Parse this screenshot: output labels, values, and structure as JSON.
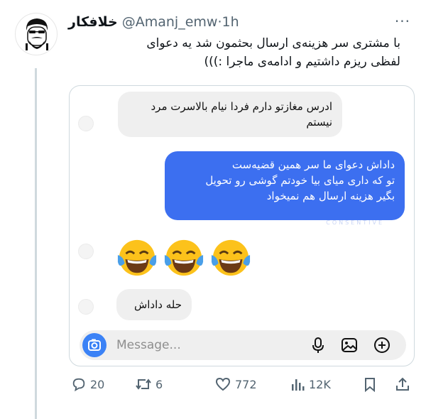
{
  "tweet": {
    "display_name": "خلافکار",
    "handle": "@Amanj_emw",
    "separator": "·",
    "time": "1h",
    "more": "···",
    "text_line1": "با مشتری سر هزینه‌ی ارسال بحثمون شد یه دعوای",
    "text_line2": "لفظی ریزم داشتیم و ادامه‌ی ماجرا :)))"
  },
  "chat": {
    "msg1": "ادرس مغازتو دارم فردا نیام بالاسرت مرد نیستم",
    "msg2_line1": "داداش دعوای ما سر همین قضیه‌ست",
    "msg2_line2": "تو که داری میای بیا خودتم گوشی رو تحویل",
    "msg2_line3": "بگیر هزینه ارسال هم نمیخواد",
    "watermark": "CONSENTIVE",
    "emojis": [
      "joy-emoji",
      "joy-emoji",
      "joy-emoji"
    ],
    "msg3": "حله داداش",
    "composer_placeholder": "Message..."
  },
  "actions": {
    "replies": "20",
    "retweets": "6",
    "likes": "772",
    "views": "12K"
  },
  "icons": [
    "comment-icon",
    "retweet-icon",
    "heart-icon",
    "views-icon",
    "bookmark-icon",
    "share-icon",
    "camera-icon",
    "mic-icon",
    "gallery-icon",
    "add-icon"
  ],
  "colors": {
    "outgoing_bubble": "#3c6ff0",
    "incoming_bubble": "#efefef",
    "secondary_text": "#536471",
    "camera_button": "#3b82f6"
  }
}
